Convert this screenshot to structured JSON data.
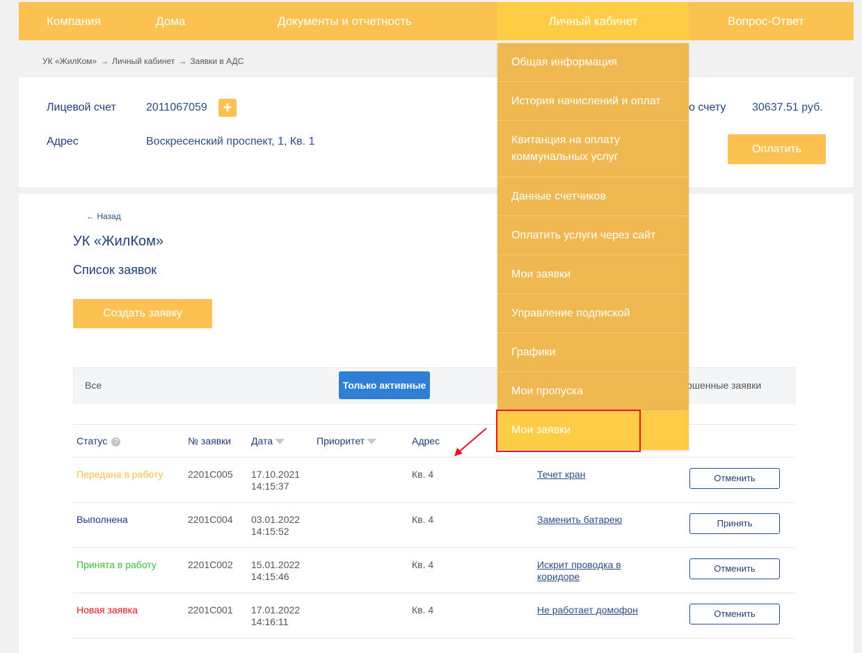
{
  "nav": {
    "items": [
      "Компания",
      "Дома",
      "Документы и отчетность",
      "Личный кабинет",
      "Вопрос-Ответ"
    ]
  },
  "breadcrumb": {
    "items": [
      "УК «ЖилКом»",
      "Личный кабинет",
      "Заявки в АДС"
    ],
    "separator": "→"
  },
  "account": {
    "account_label": "Лицевой счет",
    "account_value": "2011067059",
    "plus_label": "+",
    "address_label": "Адрес",
    "address_value": "Воскресенский проспект, 1, Кв. 1",
    "balance_label_partial": "о счету",
    "balance_value": "30637.51 руб.",
    "pay_button": "Оплатить"
  },
  "main": {
    "back_link": "← Назад",
    "org_title": "УК «ЖилКом»",
    "list_title": "Список заявок",
    "create_button": "Создать заявку"
  },
  "filters": {
    "all": "Все",
    "active": "Только активные",
    "done_partial": "ршенные заявки"
  },
  "table": {
    "headers": {
      "status": "Статус",
      "help": "?",
      "number": "№ заявки",
      "date": "Дата",
      "priority": "Приоритет",
      "address": "Адрес"
    },
    "rows": [
      {
        "status": "Передана в работу",
        "status_color": "#f6c044",
        "number": "2201С005",
        "date": "17.10.2021",
        "time": "14:15:37",
        "address": "Кв. 4",
        "description": "Течет кран",
        "action": "Отменить"
      },
      {
        "status": "Выполнена",
        "status_color": "#23328f",
        "number": "2201С004",
        "date": "03.01.2022",
        "time": "14:15:52",
        "address": "Кв. 4",
        "description": "Заменить батарею",
        "action": "Принять"
      },
      {
        "status": "Принята в работу",
        "status_color": "#3dbb3d",
        "number": "2201С002",
        "date": "15.01.2022",
        "time": "14:15:46",
        "address": "Кв. 4",
        "description": "Искрит проводка в коридоре",
        "action": "Отменить"
      },
      {
        "status": "Новая заявка",
        "status_color": "#e8131b",
        "number": "2201С001",
        "date": "17.01.2022",
        "time": "14:16:11",
        "address": "Кв. 4",
        "description": "Не работает домофон",
        "action": "Отменить"
      }
    ]
  },
  "dropdown": {
    "items": [
      "Общая информация",
      "История начислений и оплат",
      "Квитанция на оплату коммунальных услуг",
      "Данные счетчиков",
      "Оплатить услуги через сайт",
      "Мои заявки",
      "Управление подпиской",
      "Графики",
      "Мои пропуска",
      "Мои заявки"
    ]
  },
  "colors": {
    "accent": "#fcc251",
    "nav_active": "#ffcd45",
    "primary_blue": "#2f7fd6",
    "highlight_red": "#e8131b"
  }
}
